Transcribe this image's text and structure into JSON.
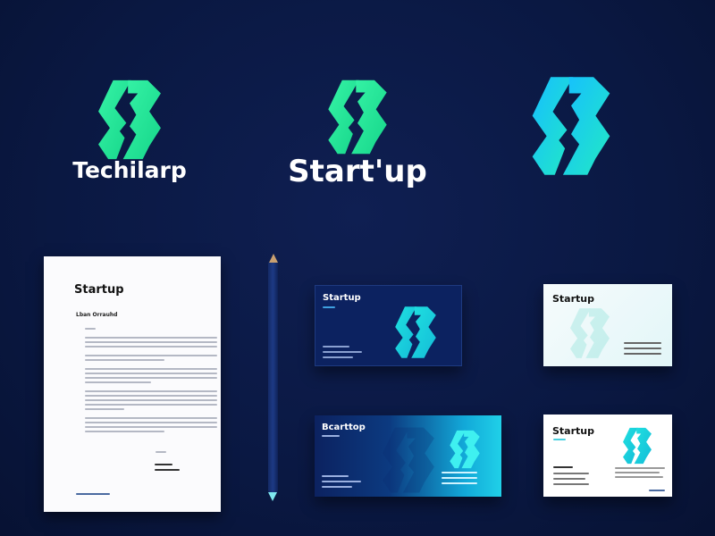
{
  "logos": [
    {
      "wordmark": "Techilarp",
      "gradient": [
        "#2ef0a0",
        "#18d98a"
      ]
    },
    {
      "wordmark": "Start'up",
      "gradient": [
        "#2ef0a0",
        "#18d98a"
      ]
    },
    {
      "wordmark": "",
      "gradient": [
        "#18c8ff",
        "#20e8c0"
      ]
    }
  ],
  "letterhead": {
    "brand": "Startup",
    "heading": "Lban Orrauhd"
  },
  "cards": {
    "dark": {
      "brand": "Startup"
    },
    "light": {
      "brand": "Startup"
    },
    "gradient": {
      "brand": "Bcarttop"
    },
    "white": {
      "brand": "Startup"
    }
  },
  "colors": {
    "background": "#0a1842",
    "accent_green": "#22e896",
    "accent_cyan": "#1fd0e0"
  }
}
